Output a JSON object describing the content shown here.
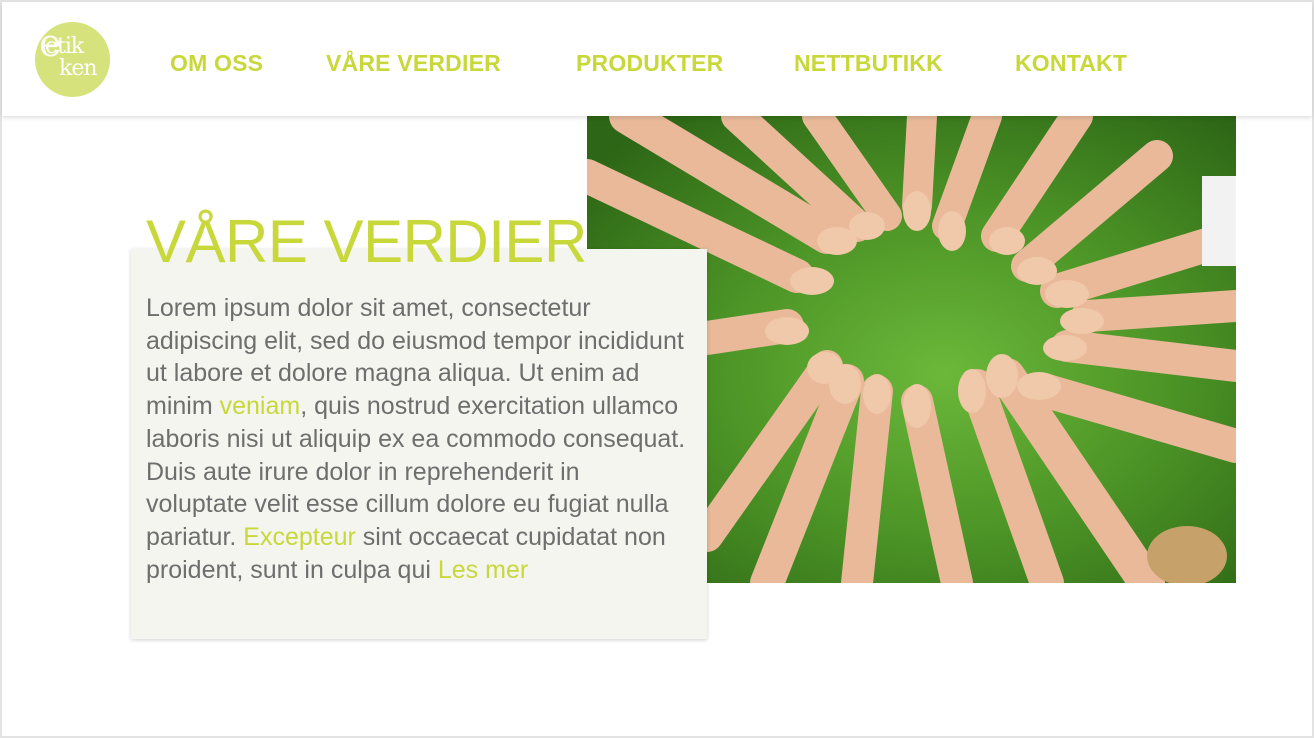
{
  "brand": {
    "logo_line1": "etik",
    "logo_line2": "ken",
    "logo_color": "#d6e27b"
  },
  "nav": {
    "items": [
      {
        "label": "OM OSS"
      },
      {
        "label": "VÅRE VERDIER"
      },
      {
        "label": "PRODUKTER"
      },
      {
        "label": "NETTBUTIKK"
      },
      {
        "label": "KONTAKT"
      }
    ],
    "color": "#c8d83b"
  },
  "hero": {
    "image_icon": "photo-hands-circle-on-grass"
  },
  "content": {
    "title": "VÅRE VERDIER",
    "p1": "Lorem ipsum dolor sit amet, consectetur adipiscing elit, sed do eiusmod tempor incididunt ut labore et dolore magna aliqua. Ut enim ad minim ",
    "hl1": "veniam",
    "p2": ", quis nostrud exercitation ullamco laboris nisi ut aliquip ex ea commodo consequat. Duis aute irure dolor in reprehenderit in voluptate velit esse cillum dolore eu fugiat nulla pariatur. ",
    "hl2": "Excepteur",
    "p3": " sint occaecat cupidatat non proident, sunt in culpa qui ",
    "read_more": "Les mer",
    "text_color": "#6e6e6e",
    "card_color": "#f4f5ef"
  }
}
